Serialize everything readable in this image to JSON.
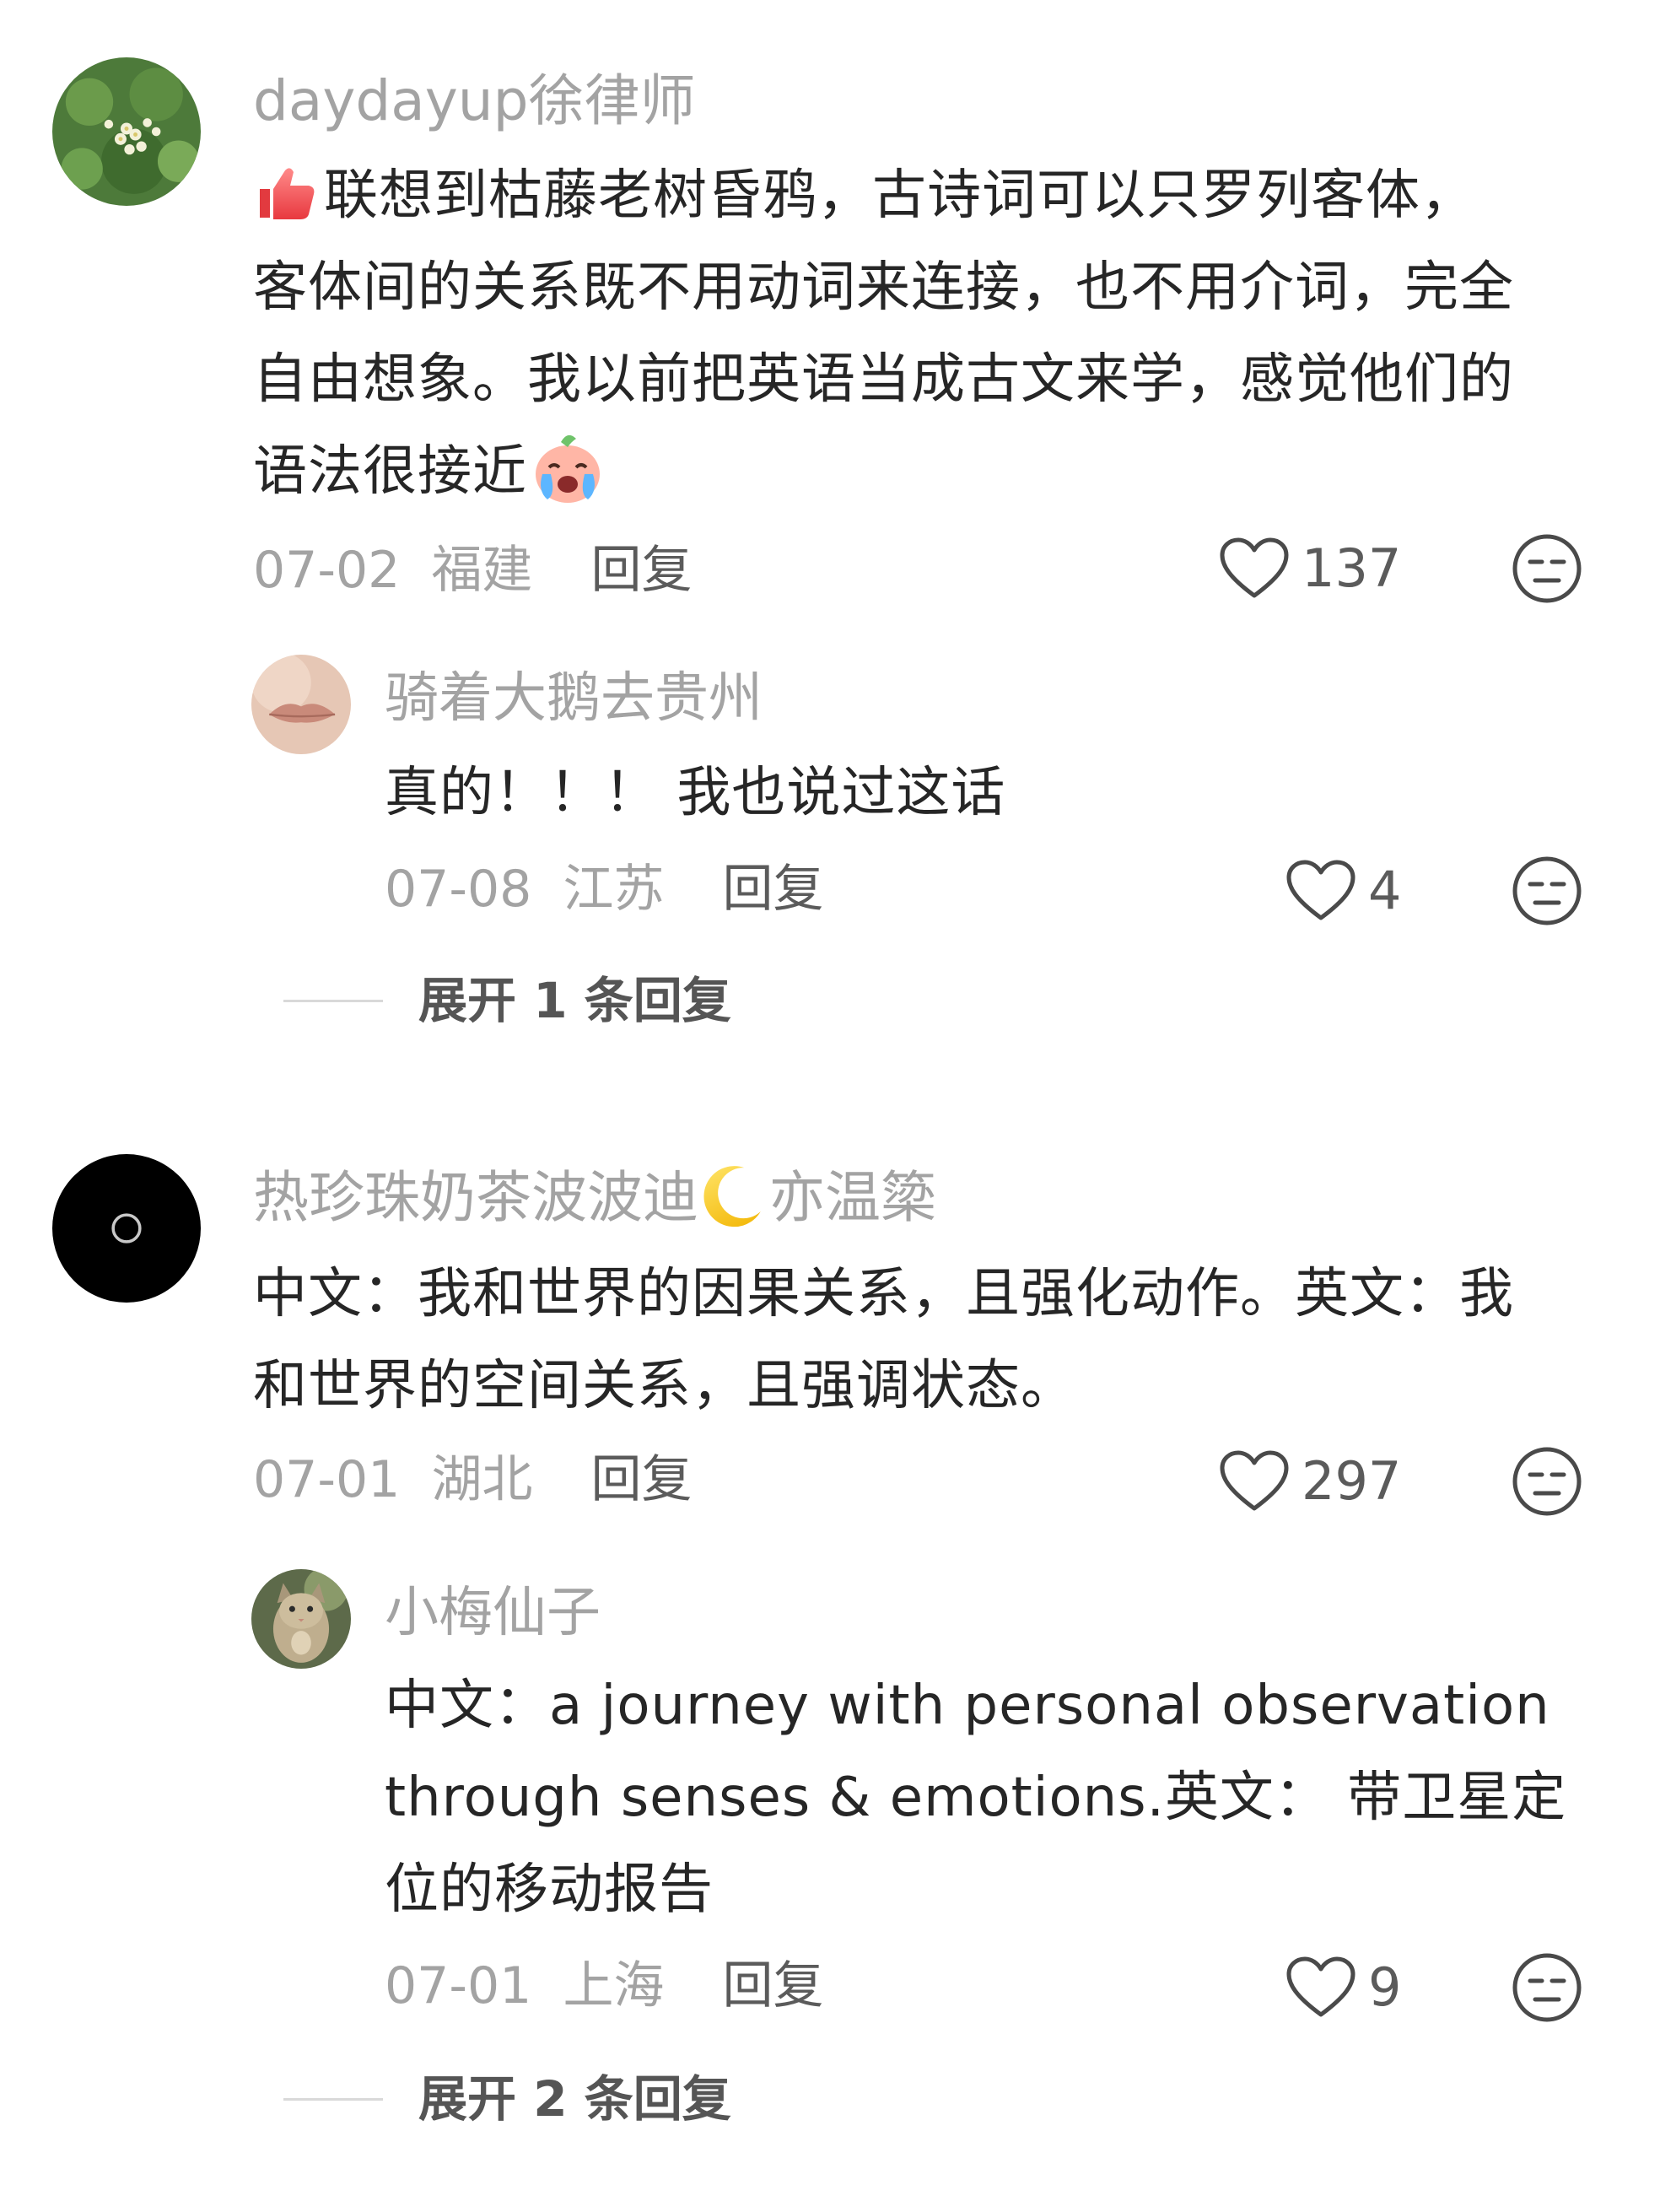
{
  "comments": [
    {
      "username": "daydayup徐律师",
      "body_lines": [
        "联想到枯藤老树昏鸦，古诗词可以只罗列客体，",
        "客体间的关系既不用动词来连接，也不用介词，完全",
        "自由想象。我以前把英语当成古文来学，感觉他们的",
        "语法很接近"
      ],
      "date": "07-02",
      "location": "福建",
      "reply_label": "回复",
      "likes": "137",
      "emoji_lead": "thumbs-up-icon",
      "emoji_tail": "crying-face-icon"
    },
    {
      "username": "骑着大鹅去贵州",
      "body_lines": [
        "真的！！！ 我也说过这话"
      ],
      "date": "07-08",
      "location": "江苏",
      "reply_label": "回复",
      "likes": "4"
    },
    {
      "username_prefix": "热珍珠奶茶波波迪",
      "username_suffix": "亦温簗",
      "username_emoji": "crescent-moon-icon",
      "body_lines": [
        "中文：我和世界的因果关系，且强化动作。英文：我",
        "和世界的空间关系，且强调状态。"
      ],
      "date": "07-01",
      "location": "湖北",
      "reply_label": "回复",
      "likes": "297"
    },
    {
      "username": "小梅仙子",
      "body_lines": [
        "中文：a journey with personal observation",
        "through senses & emotions.英文： 带卫星定",
        "位的移动报告"
      ],
      "date": "07-01",
      "location": "上海",
      "reply_label": "回复",
      "likes": "9"
    }
  ],
  "expand_1": "展开 1 条回复",
  "expand_2": "展开 2 条回复"
}
